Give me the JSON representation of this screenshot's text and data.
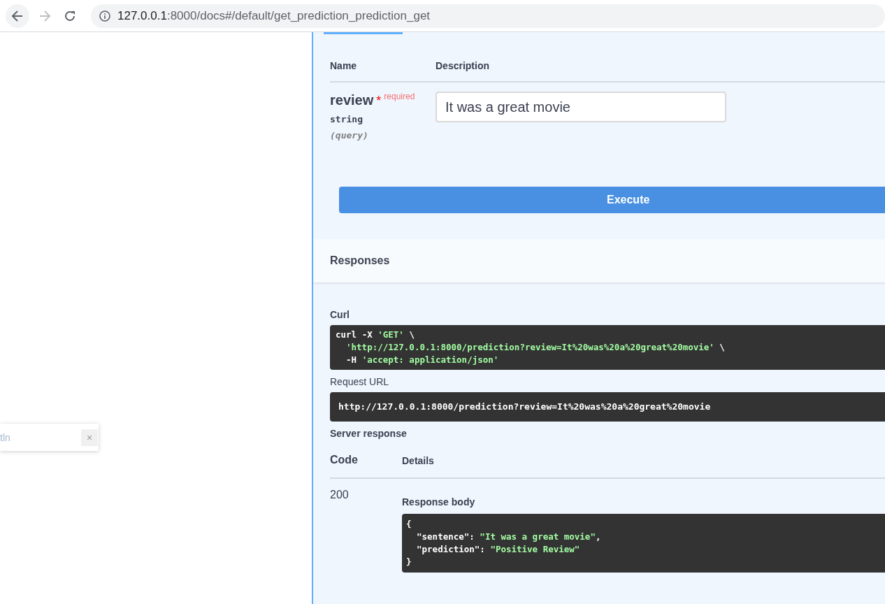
{
  "browser": {
    "url_host": "127.0.0.1",
    "url_rest": ":8000/docs#/default/get_prediction_prediction_get"
  },
  "parameters": {
    "columns": [
      "Name",
      "Description"
    ],
    "rows": [
      {
        "name": "review",
        "required_mark": "*",
        "required_label": "required",
        "type": "string",
        "location": "(query)",
        "value": "It was a great movie"
      }
    ]
  },
  "execute_button": "Execute",
  "responses": {
    "title": "Responses",
    "curl": {
      "label": "Curl",
      "lines": [
        {
          "segments": [
            {
              "kind": "plain",
              "text": "curl -X "
            },
            {
              "kind": "string",
              "text": "'GET'"
            },
            {
              "kind": "plain",
              "text": " \\"
            }
          ]
        },
        {
          "indent": true,
          "segments": [
            {
              "kind": "string",
              "text": "'http://127.0.0.1:8000/prediction?review=It%20was%20a%20great%20movie'"
            },
            {
              "kind": "plain",
              "text": " \\"
            }
          ]
        },
        {
          "indent": true,
          "segments": [
            {
              "kind": "plain",
              "text": "-H "
            },
            {
              "kind": "string",
              "text": "'accept: application/json'"
            }
          ]
        }
      ]
    },
    "request_url": {
      "label": "Request URL",
      "value": "http://127.0.0.1:8000/prediction?review=It%20was%20a%20great%20movie"
    },
    "server_response": {
      "label": "Server response",
      "columns": [
        "Code",
        "Details"
      ],
      "rows": [
        {
          "code": "200",
          "body_label": "Response body",
          "body_lines": [
            {
              "segments": [
                {
                  "kind": "plain",
                  "text": "{"
                }
              ]
            },
            {
              "indent": true,
              "segments": [
                {
                  "kind": "plain",
                  "text": "\"sentence\": "
                },
                {
                  "kind": "string",
                  "text": "\"It was a great movie\""
                },
                {
                  "kind": "plain",
                  "text": ","
                }
              ]
            },
            {
              "indent": true,
              "segments": [
                {
                  "kind": "plain",
                  "text": "\"prediction\": "
                },
                {
                  "kind": "string",
                  "text": "\"Positive Review\""
                }
              ]
            },
            {
              "segments": [
                {
                  "kind": "plain",
                  "text": "}"
                }
              ]
            }
          ]
        }
      ]
    }
  },
  "popup": {
    "text": "tln",
    "close": "×"
  }
}
